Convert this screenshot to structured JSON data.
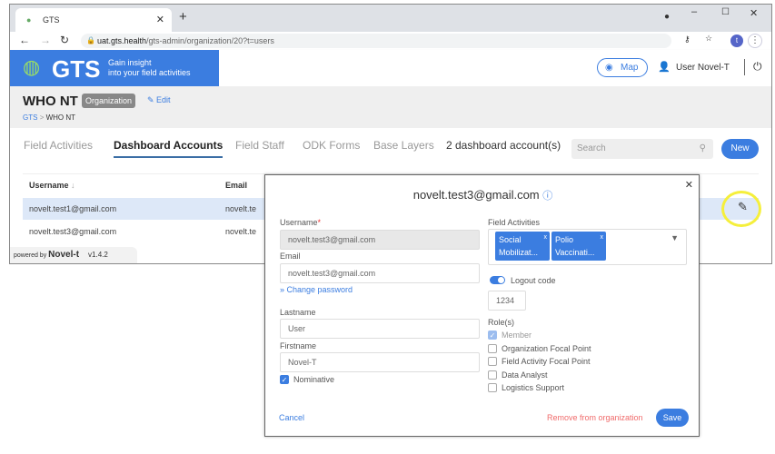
{
  "browser": {
    "tab_title": "GTS",
    "url_host": "uat.gts.health",
    "url_path": "/gts-admin/organization/20?t=users",
    "profile_initial": "t"
  },
  "header": {
    "logo": "GTS",
    "tagline1": "Gain insight",
    "tagline2": "into your field activities",
    "map_label": "Map",
    "user_name": "User Novel-T"
  },
  "page": {
    "title": "WHO NT",
    "badge": "Organization",
    "edit_label": "Edit",
    "breadcrumb": [
      "GTS",
      "WHO NT"
    ]
  },
  "tabs": [
    "Field Activities",
    "Dashboard Accounts",
    "Field Staff",
    "ODK Forms",
    "Base Layers"
  ],
  "active_tab": "Dashboard Accounts",
  "count_label": "2 dashboard account(s)",
  "search_placeholder": "Search",
  "new_label": "New",
  "table": {
    "headers": [
      "Username",
      "Email"
    ],
    "rows": [
      [
        "novelt.test1@gmail.com",
        "novelt.te"
      ],
      [
        "novelt.test3@gmail.com",
        "novelt.te"
      ]
    ]
  },
  "footer": {
    "powered_by": "powered by",
    "brand": "Novel-t",
    "version": "v1.4.2"
  },
  "modal": {
    "title": "novelt.test3@gmail.com",
    "username_label": "Username",
    "username": "novelt.test3@gmail.com",
    "email_label": "Email",
    "email": "novelt.test3@gmail.com",
    "change_password": "» Change password",
    "lastname_label": "Lastname",
    "lastname": "User",
    "firstname_label": "Firstname",
    "firstname": "Novel-T",
    "nominative_label": "Nominative",
    "nominative": true,
    "field_activities_label": "Field Activities",
    "field_activities": [
      [
        "Social",
        "Mobilizat..."
      ],
      [
        "Polio",
        "Vaccinati..."
      ]
    ],
    "logout_code_label": "Logout code",
    "logout_code_enabled": true,
    "logout_code": "1234",
    "roles_label": "Role(s)",
    "roles": [
      {
        "label": "Member",
        "checked": true
      },
      {
        "label": "Organization Focal Point",
        "checked": false
      },
      {
        "label": "Field Activity Focal Point",
        "checked": false
      },
      {
        "label": "Data Analyst",
        "checked": false
      },
      {
        "label": "Logistics Support",
        "checked": false
      }
    ],
    "cancel": "Cancel",
    "remove": "Remove from organization",
    "save": "Save"
  },
  "colors": {
    "accent": "#3b7de0",
    "danger": "#f06b6b",
    "highlight": "#f5ef3c"
  }
}
